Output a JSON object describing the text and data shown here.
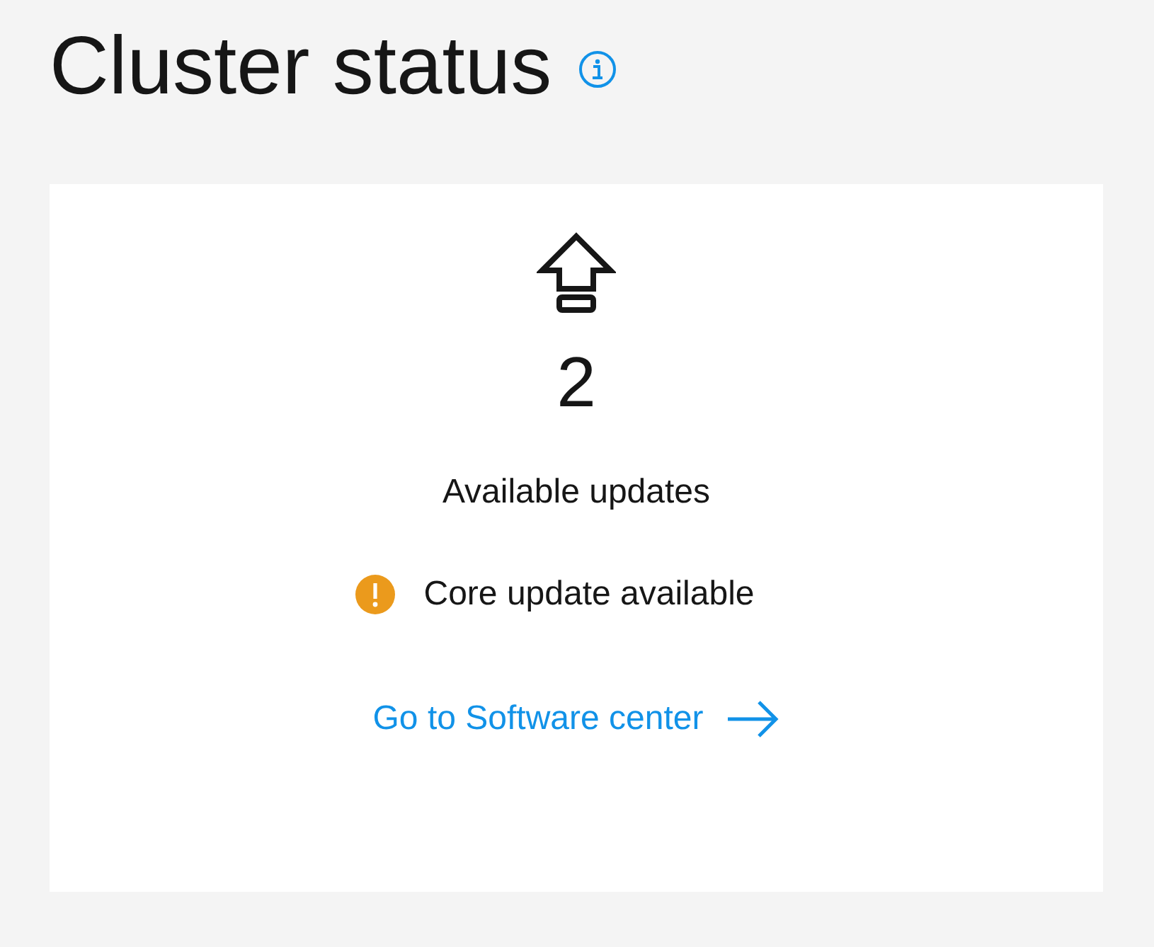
{
  "page": {
    "title": "Cluster status"
  },
  "card": {
    "count": "2",
    "label": "Available updates",
    "notice": {
      "kind": "warning",
      "text": "Core update available"
    },
    "link": {
      "text": "Go to Software center"
    }
  }
}
